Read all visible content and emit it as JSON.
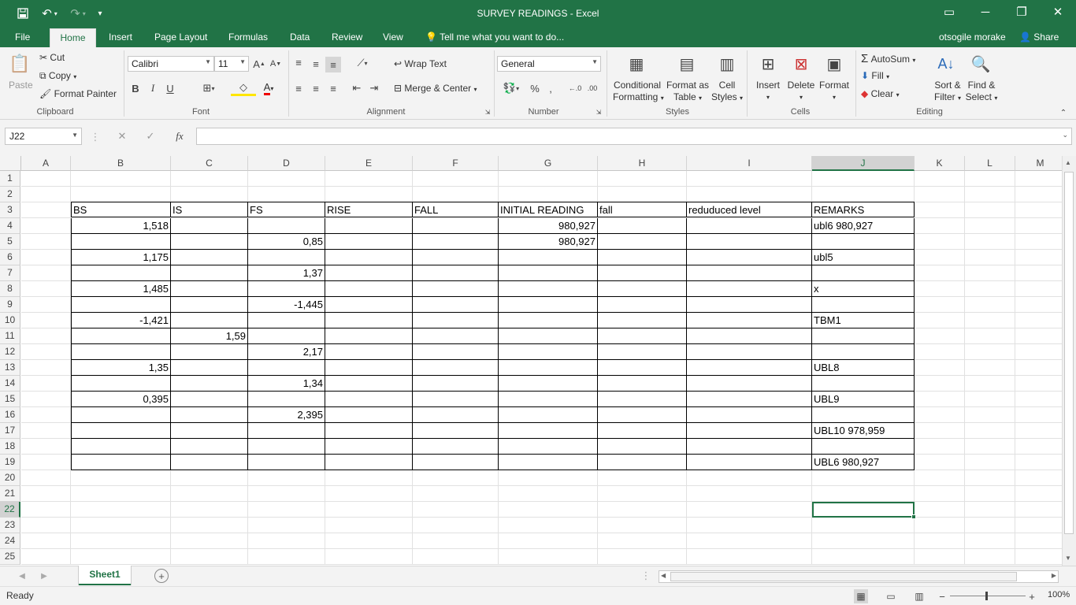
{
  "window": {
    "title": "SURVEY READINGS - Excel",
    "user": "otsogile morake",
    "share": "Share"
  },
  "tabs": {
    "file": "File",
    "home": "Home",
    "insert": "Insert",
    "page_layout": "Page Layout",
    "formulas": "Formulas",
    "data": "Data",
    "review": "Review",
    "view": "View",
    "tell_me": "Tell me what you want to do..."
  },
  "ribbon": {
    "clipboard": {
      "paste": "Paste",
      "cut": "Cut",
      "copy": "Copy",
      "format_painter": "Format Painter",
      "label": "Clipboard"
    },
    "font": {
      "name": "Calibri",
      "size": "11",
      "label": "Font"
    },
    "alignment": {
      "wrap_text": "Wrap Text",
      "merge_center": "Merge & Center",
      "label": "Alignment"
    },
    "number": {
      "format": "General",
      "label": "Number"
    },
    "styles": {
      "conditional": "Conditional",
      "conditional2": "Formatting",
      "format_as": "Format as",
      "format_as2": "Table",
      "cell": "Cell",
      "cell2": "Styles",
      "label": "Styles"
    },
    "cells": {
      "insert": "Insert",
      "delete": "Delete",
      "format": "Format",
      "label": "Cells"
    },
    "editing": {
      "autosum": "AutoSum",
      "fill": "Fill",
      "clear": "Clear",
      "sort": "Sort &",
      "sort2": "Filter",
      "find": "Find &",
      "find2": "Select",
      "label": "Editing"
    }
  },
  "formula_bar": {
    "name_box": "J22",
    "fx": "fx",
    "formula": ""
  },
  "columns": [
    "A",
    "B",
    "C",
    "D",
    "E",
    "F",
    "G",
    "H",
    "I",
    "J",
    "K",
    "L",
    "M"
  ],
  "rows": [
    "1",
    "2",
    "3",
    "4",
    "5",
    "6",
    "7",
    "8",
    "9",
    "10",
    "11",
    "12",
    "13",
    "14",
    "15",
    "16",
    "17",
    "18",
    "19",
    "20",
    "21",
    "22",
    "23",
    "24",
    "25"
  ],
  "selected": {
    "col": "J",
    "row": "22"
  },
  "cells": {
    "B3": "BS",
    "C3": "IS",
    "D3": "FS",
    "E3": "RISE",
    "F3": "FALL",
    "G3": "INITIAL READING",
    "H3": "fall",
    "I3": "reduduced level",
    "J3": "REMARKS",
    "B4": "1,518",
    "G4": "980,927",
    "J4": "ubl6       980,927",
    "D5": "0,85",
    "G5": "980,927",
    "B6": "1,175",
    "J6": "ubl5",
    "D7": "1,37",
    "B8": "1,485",
    "J8": "x",
    "D9": "-1,445",
    "B10": "-1,421",
    "J10": "TBM1",
    "C11": "1,59",
    "D12": "2,17",
    "B13": "1,35",
    "J13": "UBL8",
    "D14": "1,34",
    "B15": "0,395",
    "J15": "UBL9",
    "D16": "2,395",
    "J17": "UBL10     978,959",
    "J19": "UBL6 980,927"
  },
  "sheets": [
    "Sheet1"
  ],
  "status": {
    "ready": "Ready",
    "zoom": "100%"
  }
}
